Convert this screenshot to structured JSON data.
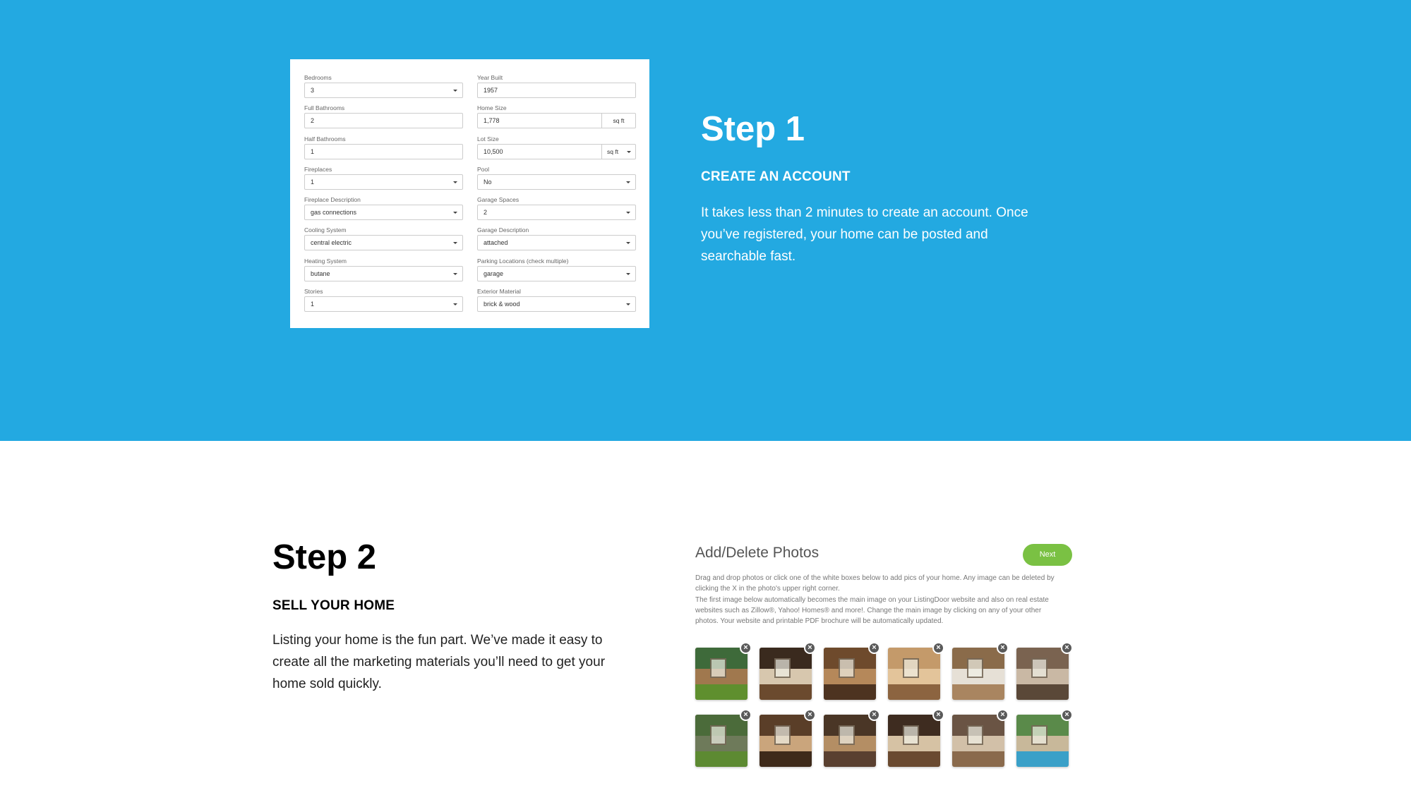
{
  "step1": {
    "title": "Step 1",
    "subtitle": "CREATE AN ACCOUNT",
    "body": "It takes less than 2 minutes to create an account. Once you’ve registered, your home can be posted and searchable fast."
  },
  "form": {
    "left": [
      {
        "label": "Bedrooms",
        "value": "3"
      },
      {
        "label": "Full Bathrooms",
        "value": "2"
      },
      {
        "label": "Half Bathrooms",
        "value": "1"
      },
      {
        "label": "Fireplaces",
        "value": "1"
      },
      {
        "label": "Fireplace Description",
        "value": "gas connections"
      },
      {
        "label": "Cooling System",
        "value": "central electric"
      },
      {
        "label": "Heating System",
        "value": "butane"
      },
      {
        "label": "Stories",
        "value": "1"
      }
    ],
    "right": [
      {
        "label": "Year Built",
        "value": "1957"
      },
      {
        "label": "Home Size",
        "value": "1,778",
        "unit": "sq ft"
      },
      {
        "label": "Lot Size",
        "value": "10,500",
        "unit": "sq ft"
      },
      {
        "label": "Pool",
        "value": "No"
      },
      {
        "label": "Garage Spaces",
        "value": "2"
      },
      {
        "label": "Garage Description",
        "value": "attached"
      },
      {
        "label": "Parking Locations (check multiple)",
        "value": "garage"
      },
      {
        "label": "Exterior Material",
        "value": "brick & wood"
      }
    ]
  },
  "step2": {
    "title": "Step 2",
    "subtitle": "SELL YOUR HOME",
    "body": "Listing your home is the fun part. We’ve made it easy to create all the marketing materials you’ll need to get your home sold quickly."
  },
  "photos": {
    "title": "Add/Delete Photos",
    "next_label": "Next",
    "desc_line1": "Drag and drop photos or click one of the white boxes below to add pics of your home. Any image can be deleted by clicking the X in the photo's upper right corner.",
    "desc_line2": "The first image below automatically becomes the main image on your ListingDoor website and also on real estate websites such as Zillow®, Yahoo! Homes® and more!. Change the main image by clicking on any of your other photos. Your website and printable PDF brochure will be automatically updated.",
    "delete_glyph": "×",
    "thumbnails": [
      {
        "name": "exterior-front",
        "top": "#3e6a3a",
        "mid": "#a0784e",
        "bottom": "#5f8f2e"
      },
      {
        "name": "kitchen",
        "top": "#3a2a1e",
        "mid": "#d7c7ae",
        "bottom": "#6b4a2e"
      },
      {
        "name": "dining-room",
        "top": "#6e4a2c",
        "mid": "#b5885a",
        "bottom": "#4d3320"
      },
      {
        "name": "living-room",
        "top": "#c49a6a",
        "mid": "#e3c49a",
        "bottom": "#8c6440"
      },
      {
        "name": "bedroom-window",
        "top": "#8a6b4a",
        "mid": "#e6e0d6",
        "bottom": "#a98560"
      },
      {
        "name": "bathroom",
        "top": "#7a6350",
        "mid": "#c9b8a4",
        "bottom": "#5a4838"
      },
      {
        "name": "backyard",
        "top": "#4b6b3a",
        "mid": "#6e7a5a",
        "bottom": "#5d8a32"
      },
      {
        "name": "dining-table",
        "top": "#5a3e28",
        "mid": "#caa57c",
        "bottom": "#3e2a1a"
      },
      {
        "name": "family-room",
        "top": "#4a3626",
        "mid": "#b48e64",
        "bottom": "#5a4030"
      },
      {
        "name": "staircase",
        "top": "#3e2c20",
        "mid": "#d6c2a4",
        "bottom": "#6a4a30"
      },
      {
        "name": "master-bedroom",
        "top": "#6a5444",
        "mid": "#d2c0a8",
        "bottom": "#8a6a4c"
      },
      {
        "name": "pool",
        "top": "#5a8a4a",
        "mid": "#c8b89a",
        "bottom": "#3aa0c8"
      }
    ]
  }
}
